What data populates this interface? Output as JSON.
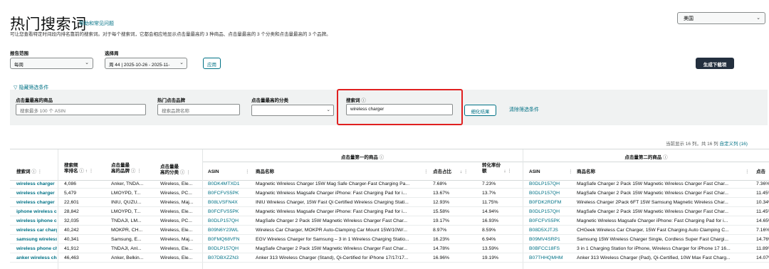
{
  "header": {
    "title": "热门搜索词",
    "help_link": "帮助和常见问题",
    "subtitle": "可让您查看特定时间段内排名靠前的搜索词。对于每个搜索词，它都会相应地显示点击量最高的 3 种商品、点击量最高的 3 个分类和点击量最高的 3 个品牌。",
    "marketplace": "美国"
  },
  "controls": {
    "report_range_label": "报告范围",
    "report_range_value": "每周",
    "week_label": "选择周",
    "week_value": "周 44 | 2025-10-26 - 2025-11-",
    "apply_label": "应用",
    "download_label": "生成下载项"
  },
  "filters": {
    "toggle_label": "隐藏筛选条件",
    "asin_label": "点击量最高的商品",
    "asin_placeholder": "搜索最多 100 个 ASIN",
    "brand_label": "热门点击品牌",
    "brand_placeholder": "搜索品牌名称",
    "category_label": "点击量最高的分类",
    "category_value": "",
    "term_label": "搜索词",
    "term_value": "wireless charger",
    "refine_label": "细化结果",
    "clear_label": "清除筛选条件"
  },
  "table_meta": {
    "count_text": "当前显示 16 列，共 16 列",
    "custom_columns": "自定义列 (16)"
  },
  "columns": {
    "group_first": "点击量第一的商品",
    "group_second": "点击量第二的商品",
    "term": "搜索词",
    "rank_l1": "搜索频",
    "rank_l2": "率排名",
    "brands_l1": "点击量最",
    "brands_l2": "高的品牌",
    "cats_l1": "点击量最",
    "cats_l2": "高的分类",
    "asin": "ASIN",
    "product": "商品名称",
    "click_share": "点击占比",
    "conv_l1": "转化率份",
    "conv_l2": "额",
    "asin2": "ASIN",
    "product2": "商品名称",
    "click_share2": "点击"
  },
  "rows": [
    {
      "term": "wireless charger",
      "rank": "4,086",
      "brands": "Anker, TNDA...",
      "cats": "Wireless, Ele...",
      "asin": "B0DK4MTXD1",
      "product": "Magnetic Wireless Charger 15W Mag Safe Charger-Fast Charging Pa...",
      "share": "7.68%",
      "conv": "7.23%",
      "asin2": "B0DLP157QH",
      "product2": "MagSafe Charger 2 Pack 15W Magnetic Wireless Charger Fast Char...",
      "share2": "7.36%"
    },
    {
      "term": "wireless charger",
      "rank": "5,479",
      "brands": "LMOYPD, T...",
      "cats": "Wireless, PC...",
      "asin": "B0FCFVS5PK",
      "product": "Magnetic Wireless Magsafe Charger iPhone: Fast Charging Pad for i...",
      "share": "13.67%",
      "conv": "13.7%",
      "asin2": "B0DLP157QH",
      "product2": "MagSafe Charger 2 Pack 15W Magnetic Wireless Charger Fast Char...",
      "share2": "11.45%"
    },
    {
      "term": "wireless charger",
      "rank": "22,601",
      "brands": "INIU, QUZU...",
      "cats": "Wireless, Maj...",
      "asin": "B08LVSFN4X",
      "product": "INIU Wireless Charger, 15W Fast Qi Certified Wireless Charging Stati...",
      "share": "12.93%",
      "conv": "11.75%",
      "asin2": "B0FDK2RDFM",
      "product2": "Wireless Charger 2Pack 6FT 15W Samsung Magnetic Wireless Char...",
      "share2": "10.34%"
    },
    {
      "term": "iphone wireless charger",
      "rank": "28,842",
      "brands": "LMOYPD, T...",
      "cats": "Wireless, Ele...",
      "asin": "B0FCFVS5PK",
      "product": "Magnetic Wireless Magsafe Charger iPhone: Fast Charging Pad for i...",
      "share": "15.58%",
      "conv": "14.94%",
      "asin2": "B0DLP157QH",
      "product2": "MagSafe Charger 2 Pack 15W Magnetic Wireless Charger Fast Char...",
      "share2": "11.45%"
    },
    {
      "term": "wireless iphone charger",
      "rank": "32,035",
      "brands": "TNDAJI, LM...",
      "cats": "Wireless, PC...",
      "asin": "B0DLP157QH",
      "product": "MagSafe Charger 2 Pack 15W Magnetic Wireless Charger Fast Char...",
      "share": "19.17%",
      "conv": "16.93%",
      "asin2": "B0FCFVS5PK",
      "product2": "Magnetic Wireless Magsafe Charger iPhone: Fast Charging Pad for i...",
      "share2": "14.65%"
    },
    {
      "term": "wireless car charger",
      "rank": "40,242",
      "brands": "MOKPR, CH...",
      "cats": "Wireless, Ele...",
      "asin": "B09N6Y23WL",
      "product": "Wireless Car Charger, MOKPR Auto-Clamping Car Mount 15W/10W/...",
      "share": "8.97%",
      "conv": "8.59%",
      "asin2": "B08D5XJTJS",
      "product2": "CHGeek Wireless Car Charger, 15W Fast Charging Auto Clamping C...",
      "share2": "7.16%"
    },
    {
      "term": "samsung wireless charger",
      "rank": "40,341",
      "brands": "Samsung, E...",
      "cats": "Wireless, Maj...",
      "asin": "B0FMQ68VFN",
      "product": "EGV Wireless Charger for Samsung – 3 in 1 Wireless Charging Statio...",
      "share": "16.23%",
      "conv": "6.94%",
      "asin2": "B09MV4SRP1",
      "product2": "Samsung 15W Wireless Charger Single, Cordless Super Fast Chargi...",
      "share2": "14.76%"
    },
    {
      "term": "wireless phone charger",
      "rank": "41,912",
      "brands": "TNDAJI, Anl...",
      "cats": "Wireless, Ele...",
      "asin": "B0DLP157QH",
      "product": "MagSafe Charger 2 Pack 15W Magnetic Wireless Charger Fast Char...",
      "share": "14.78%",
      "conv": "13.59%",
      "asin2": "B0BFCC18FS",
      "product2": "3 in 1 Charging Station for iPhone, Wireless Charger for iPhone 17 16...",
      "share2": "11.89%"
    },
    {
      "term": "anker wireless charger",
      "rank": "46,463",
      "brands": "Anker, Belkin...",
      "cats": "Wireless, Ele...",
      "asin": "B07DBXZZN3",
      "product": "Anker 313 Wireless Charger (Stand), Qi-Certified for iPhone 17/17/17...",
      "share": "16.96%",
      "conv": "19.19%",
      "asin2": "B07THHQMHM",
      "product2": "Anker 313 Wireless Charger (Pad), Qi-Certified, 10W Max Fast Charg...",
      "share2": "14.07%"
    }
  ]
}
